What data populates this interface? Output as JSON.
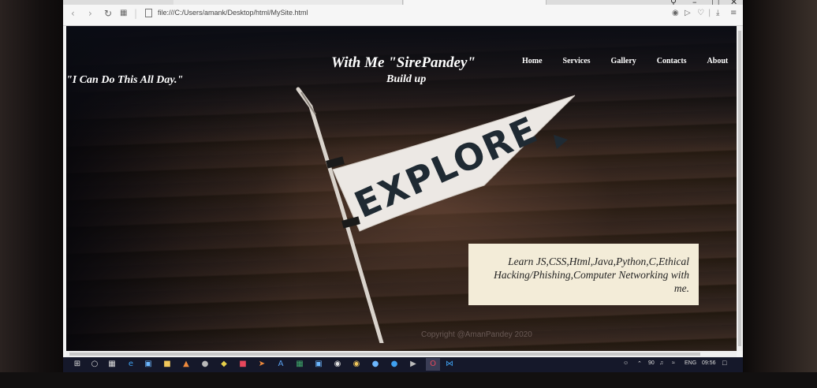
{
  "browser": {
    "address": "file:///C:/Users/amank/Desktop/html/MySite.html",
    "win_min": "–",
    "win_max": "□",
    "win_close": "✕"
  },
  "site": {
    "title": "With Me \"SirePandey\"",
    "subtitle": "Build up",
    "quote": "\"I Can Do This All Day.\"",
    "nav": [
      "Home",
      "Services",
      "Gallery",
      "Contacts",
      "About"
    ],
    "flag_text": "EXPLORE",
    "info": "Learn JS,CSS,Html,Java,Python,C,Ethical Hacking/Phishing,Computer Networking with me.",
    "copyright": "Copyright @AmanPandey 2020"
  },
  "taskbar": {
    "tray": {
      "battery": "90",
      "language": "ENG",
      "time": "09:56"
    }
  },
  "colors": {
    "taskbar": "#15182a",
    "info_box": "#f3ecd8",
    "flag_fabric": "#ece8e4",
    "flag_letters": "#1f2a33"
  }
}
